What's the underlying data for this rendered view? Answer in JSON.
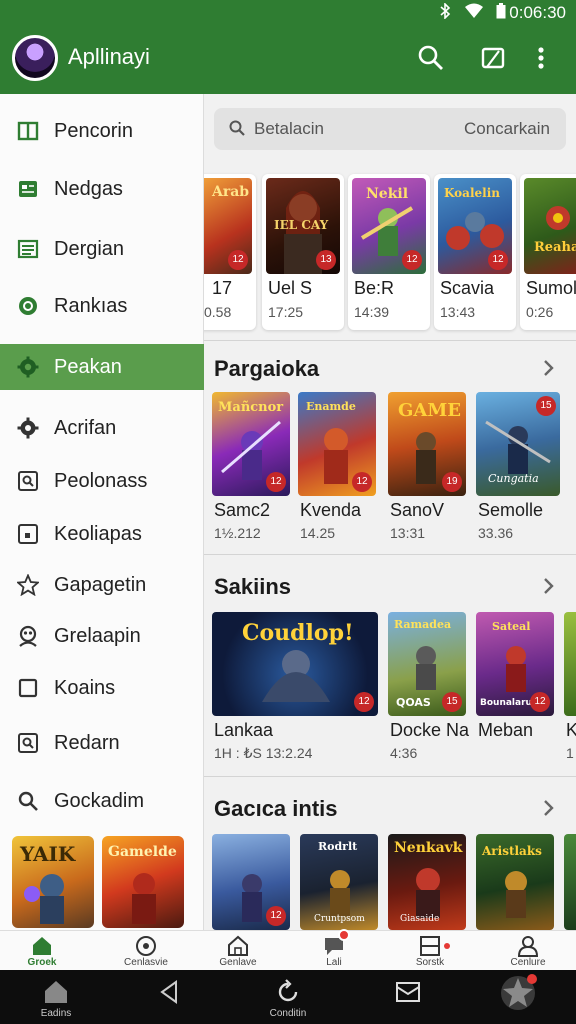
{
  "status": {
    "time": "0:06:30"
  },
  "app": {
    "title": "Apllinayi"
  },
  "colors": {
    "primary": "#2f7d32",
    "active_item": "#5a9d4c",
    "badge": "#c62828"
  },
  "drawer": {
    "items": [
      {
        "label": "Pencorin",
        "icon": "grid-icon"
      },
      {
        "label": "Nedgas",
        "icon": "news-icon"
      },
      {
        "label": "Dergian",
        "icon": "list-icon"
      },
      {
        "label": "Rankıas",
        "icon": "badge-icon"
      },
      {
        "label": "Peakan",
        "icon": "gear-icon",
        "active": true
      },
      {
        "label": "Acrifan",
        "icon": "settings-icon"
      },
      {
        "label": "Peolonass",
        "icon": "square-search-icon"
      },
      {
        "label": "Keoliapas",
        "icon": "square-dot-icon"
      },
      {
        "label": "Gapagetin",
        "icon": "star-icon"
      },
      {
        "label": "Grelaapin",
        "icon": "people-icon"
      },
      {
        "label": "Koains",
        "icon": "square-icon"
      },
      {
        "label": "Redarn",
        "icon": "square-search-icon"
      },
      {
        "label": "Gockadim",
        "icon": "search-icon"
      }
    ],
    "thumb_texts": [
      "YAIK",
      "Gamelde"
    ]
  },
  "search": {
    "placeholder": "Betalacin",
    "right_label": "Concarkain"
  },
  "top_row": [
    {
      "name": "17",
      "meta": "0.58",
      "art_text": "Arab"
    },
    {
      "name": "Uel S",
      "meta": "17:25",
      "art_text": "IEL CAY"
    },
    {
      "name": "Be:R",
      "meta": "14:39",
      "art_text": "Nekil"
    },
    {
      "name": "Scavia",
      "meta": "13:43",
      "art_text": "Koalelin"
    },
    {
      "name": "Sumol",
      "meta": "0:26",
      "art_text": "Reaha"
    }
  ],
  "sections": [
    {
      "title": "Pargaioka",
      "items": [
        {
          "name": "Samc2",
          "meta": "1½.212",
          "art_text": "Mañcnor",
          "badge": ""
        },
        {
          "name": "Kvenda",
          "meta": "14.25",
          "art_text": "Enamde",
          "badge": "12"
        },
        {
          "name": "SanoV",
          "meta": "13:31",
          "art_text": "GAME",
          "badge": "19"
        },
        {
          "name": "Semolle",
          "meta": "33.36",
          "art_text": "Cungatia",
          "badge": "15"
        }
      ]
    },
    {
      "title": "Sakiins",
      "items": [
        {
          "name": "Lankaa",
          "meta": "1H : ₺S 13:2.24",
          "art_text": "Coudlop!"
        },
        {
          "name": "Docke Na",
          "meta": "4:36",
          "art_text": "Ramadea",
          "sub_text": "QOAS"
        },
        {
          "name": "Meban",
          "meta": "",
          "art_text": "Sateal",
          "sub_text": "Bounalarue"
        },
        {
          "name": "K",
          "meta": "1",
          "art_text": ""
        }
      ]
    },
    {
      "title": "Gacıca intis",
      "items": [
        {
          "name": "",
          "meta": "",
          "art_text": ""
        },
        {
          "name": "",
          "meta": "",
          "art_text": "Rodrlt",
          "sub_text": "Cruntpsom"
        },
        {
          "name": "",
          "meta": "",
          "art_text": "Nenkavk",
          "sub_text": "Giasaide"
        },
        {
          "name": "",
          "meta": "",
          "art_text": "Aristlaks"
        }
      ]
    }
  ],
  "bottom_nav": [
    {
      "label": "Groek",
      "icon": "home-icon",
      "active": true
    },
    {
      "label": "Cenlasvie",
      "icon": "target-icon"
    },
    {
      "label": "Genlave",
      "icon": "house-outline-icon"
    },
    {
      "label": "Lali",
      "icon": "chat-icon"
    },
    {
      "label": "Sorstk",
      "icon": "window-icon"
    },
    {
      "label": "Cenlure",
      "icon": "person-icon"
    }
  ],
  "system_nav": [
    {
      "label": "Eadins",
      "icon": "home-filled-icon"
    },
    {
      "label": "",
      "icon": "back-icon"
    },
    {
      "label": "Conditin",
      "icon": "refresh-icon"
    },
    {
      "label": "",
      "icon": "mail-icon"
    },
    {
      "label": "",
      "icon": "game-avatar-icon"
    }
  ]
}
